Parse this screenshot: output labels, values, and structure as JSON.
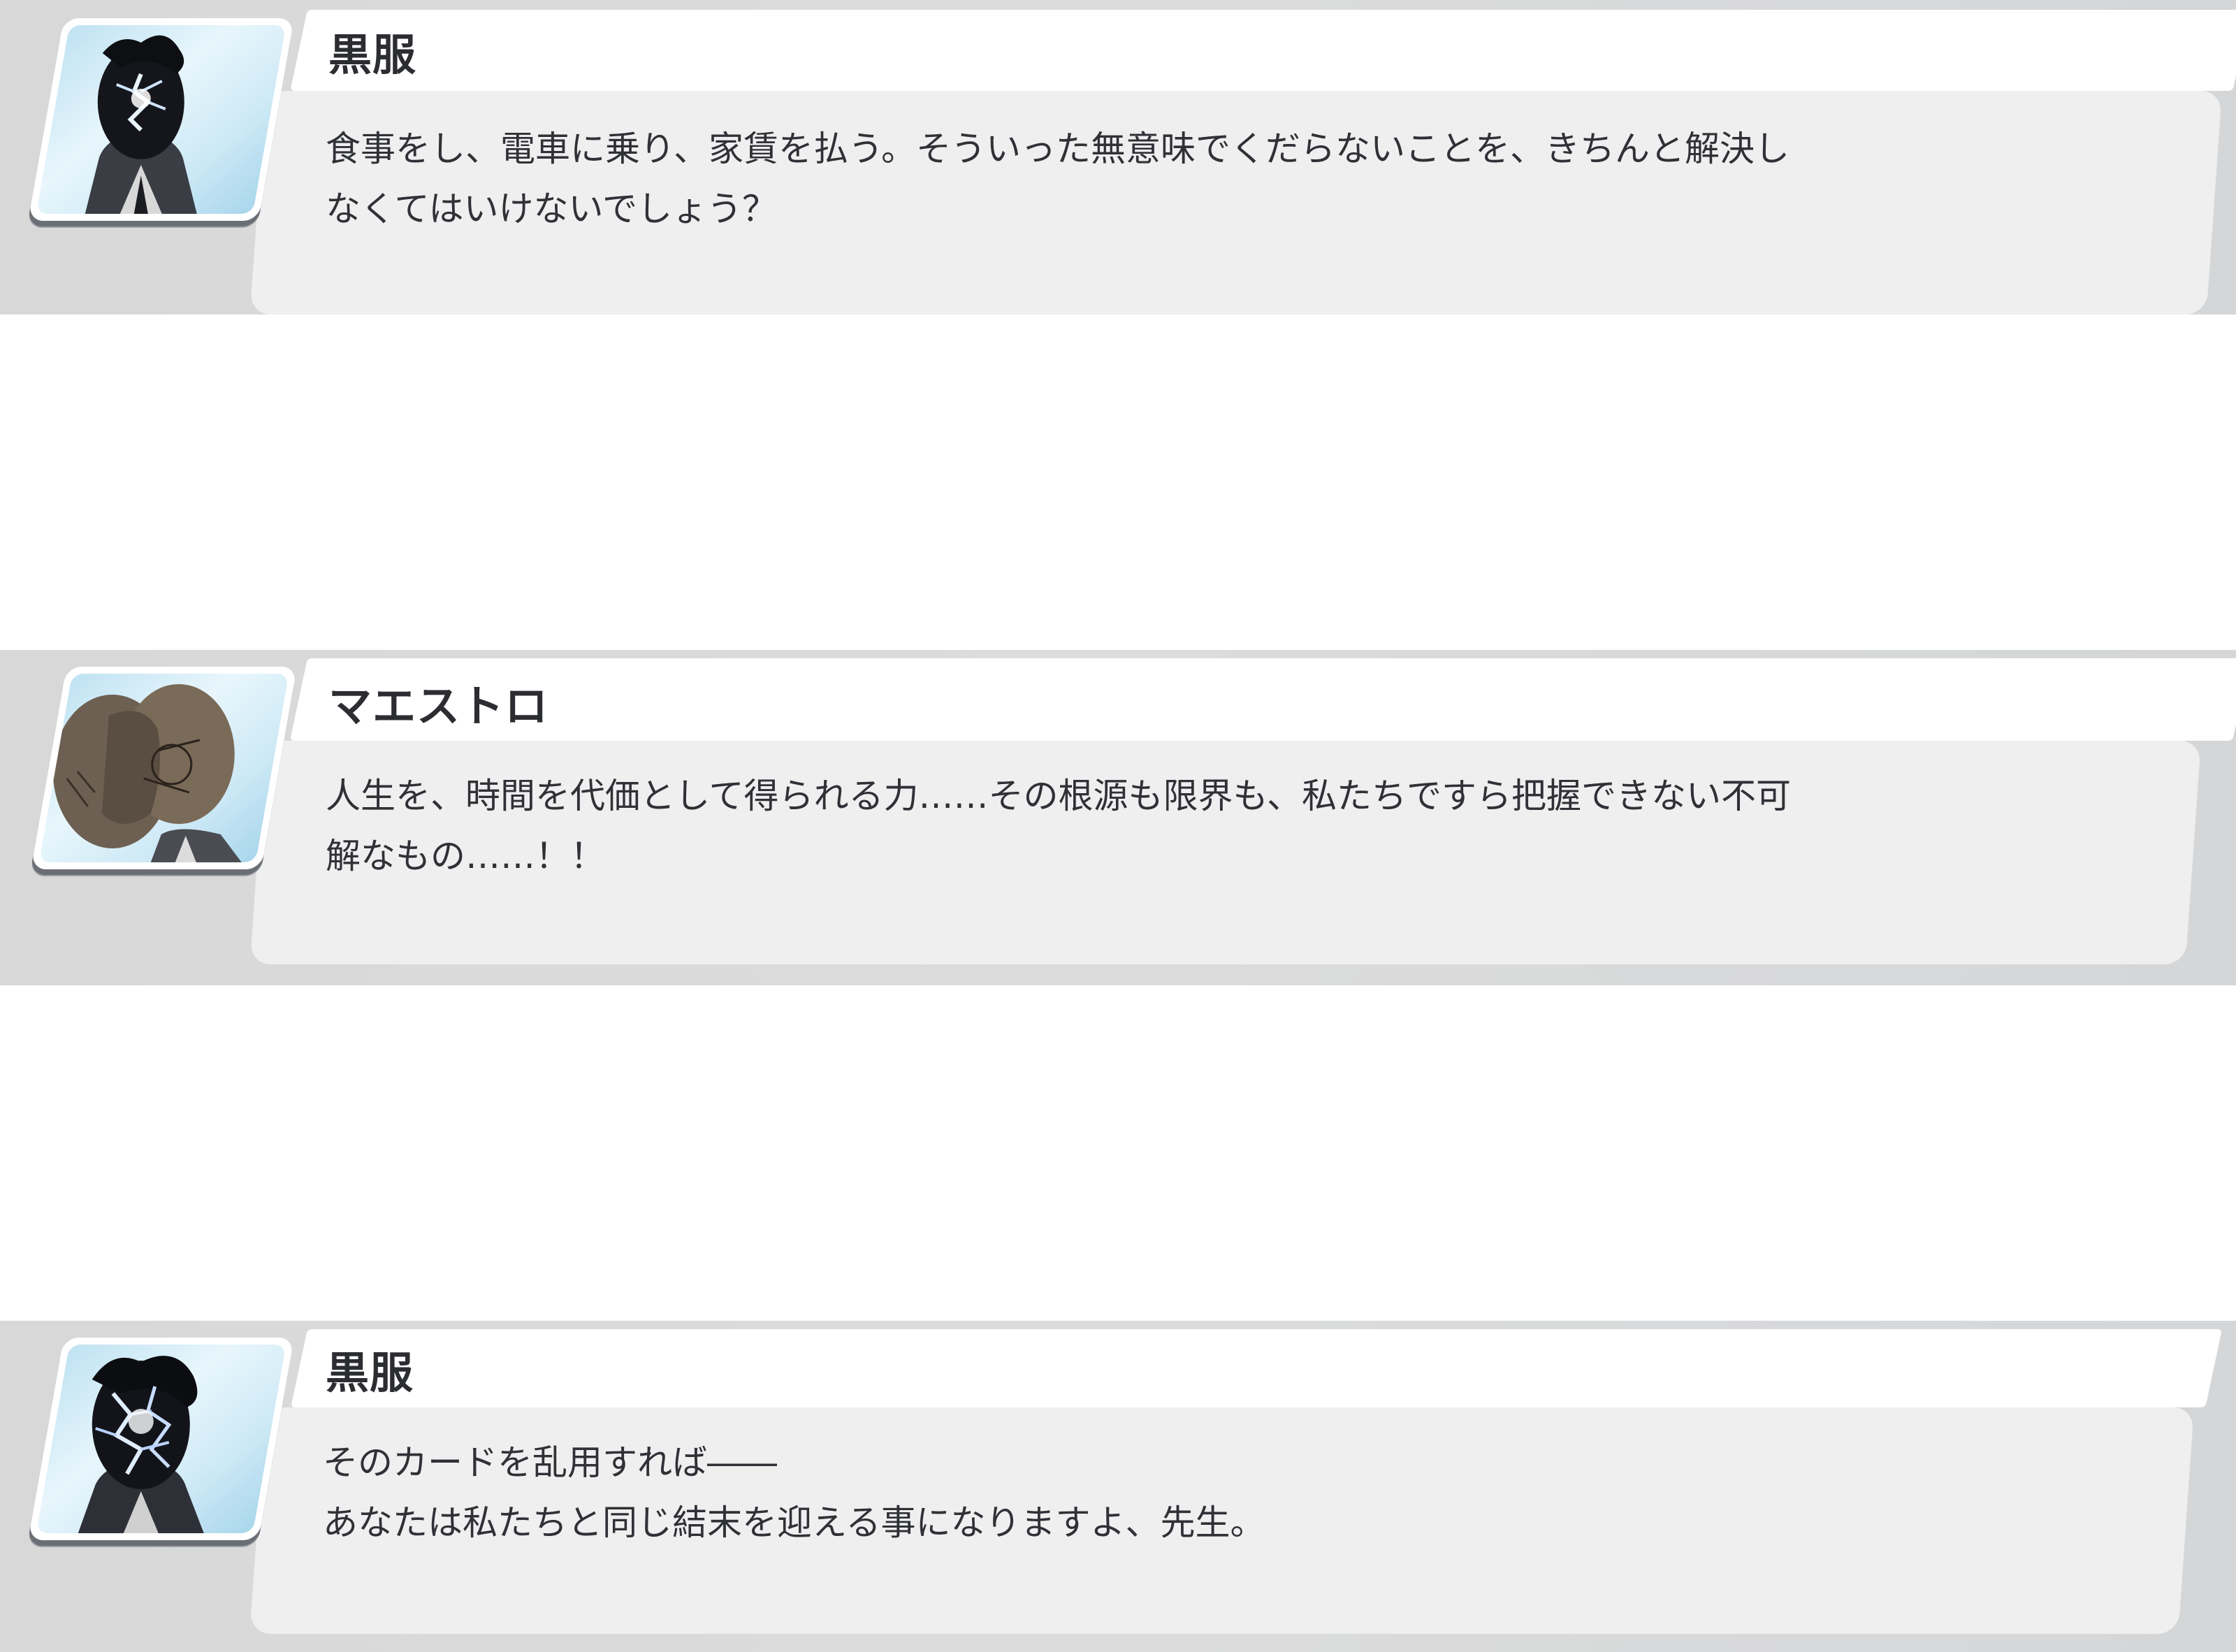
{
  "dialogues": [
    {
      "speaker": "黒服",
      "avatar_icon": "kurofuku-portrait-icon",
      "line1": "食事をし、電車に乗り、家賃を払う。そういった無意味でくだらないことを、きちんと解決し",
      "line2": "なくてはいけないでしょう？"
    },
    {
      "speaker": "マエストロ",
      "avatar_icon": "maestro-portrait-icon",
      "line1": "人生を、時間を代価として得られる力……その根源も限界も、私たちですら把握できない不可",
      "line2": "解なもの……！！"
    },
    {
      "speaker": "黒服",
      "avatar_icon": "kurofuku-portrait-icon",
      "line1": "そのカードを乱用すれば――",
      "line2": "あなたは私たちと同じ結末を迎える事になりますよ、先生。"
    }
  ]
}
